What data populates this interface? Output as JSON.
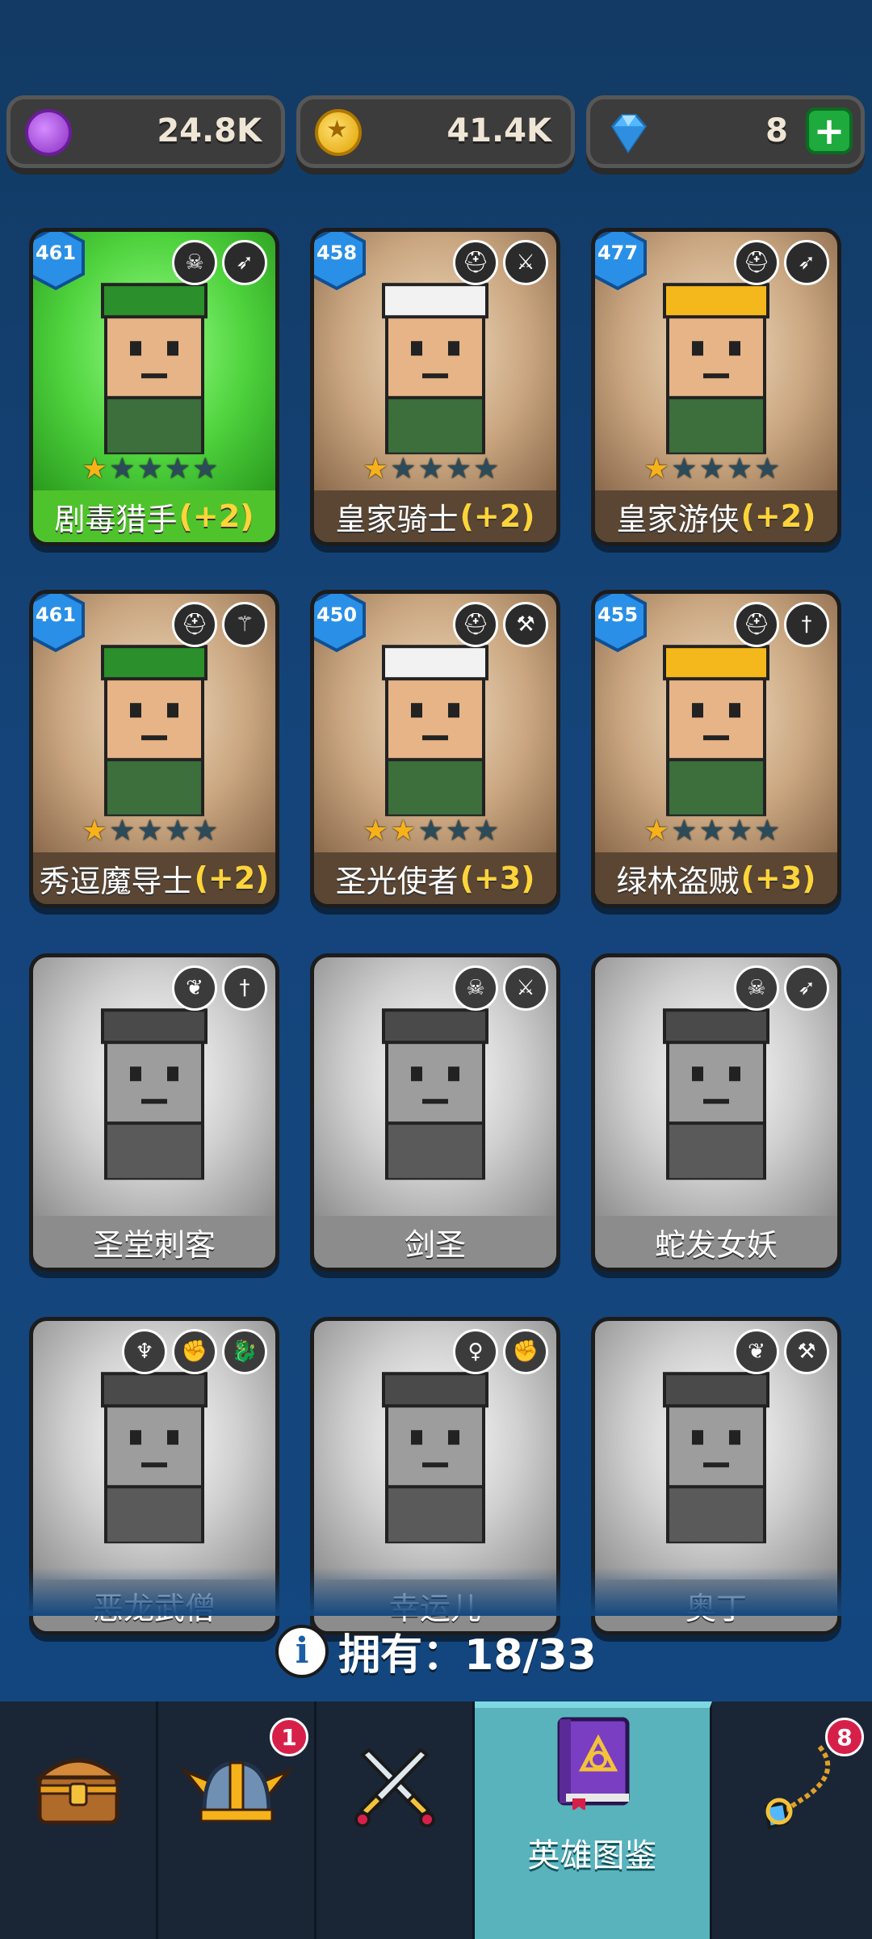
{
  "currencies": [
    {
      "name": "purple-coin",
      "value": "24.8K"
    },
    {
      "name": "gold-coin",
      "value": "41.4K"
    },
    {
      "name": "gem",
      "value": "8",
      "plus": "+"
    }
  ],
  "heroes": [
    {
      "name": "剧毒猎手",
      "bonus": "(+2)",
      "level": "461",
      "stars": 1,
      "owned": true,
      "theme": "green",
      "badges": [
        "orc-icon",
        "bow-icon"
      ]
    },
    {
      "name": "皇家骑士",
      "bonus": "(+2)",
      "level": "458",
      "stars": 1,
      "owned": true,
      "theme": "brown",
      "badges": [
        "helmet-icon",
        "sword-icon"
      ]
    },
    {
      "name": "皇家游侠",
      "bonus": "(+2)",
      "level": "477",
      "stars": 1,
      "owned": true,
      "theme": "brown",
      "badges": [
        "helmet-icon",
        "bow-icon"
      ]
    },
    {
      "name": "秀逗魔导士",
      "bonus": "(+2)",
      "level": "461",
      "stars": 1,
      "owned": true,
      "theme": "brown",
      "badges": [
        "helmet-icon",
        "staff-icon"
      ]
    },
    {
      "name": "圣光使者",
      "bonus": "(+3)",
      "level": "450",
      "stars": 2,
      "owned": true,
      "theme": "brown",
      "badges": [
        "helmet-icon",
        "hammer-icon"
      ]
    },
    {
      "name": "绿林盗贼",
      "bonus": "(+3)",
      "level": "455",
      "stars": 1,
      "owned": true,
      "theme": "brown",
      "badges": [
        "helmet-icon",
        "dagger-icon"
      ]
    },
    {
      "name": "圣堂刺客",
      "bonus": "",
      "level": "",
      "stars": 0,
      "owned": false,
      "badges": [
        "wings-icon",
        "dagger-icon"
      ]
    },
    {
      "name": "剑圣",
      "bonus": "",
      "level": "",
      "stars": 0,
      "owned": false,
      "badges": [
        "orc-icon",
        "sword-icon"
      ]
    },
    {
      "name": "蛇发女妖",
      "bonus": "",
      "level": "",
      "stars": 0,
      "owned": false,
      "badges": [
        "skull-icon",
        "bow-icon"
      ]
    },
    {
      "name": "恶龙武僧",
      "bonus": "",
      "level": "",
      "stars": 0,
      "owned": false,
      "badges": [
        "demon-icon",
        "fist-icon",
        "dragon-icon"
      ]
    },
    {
      "name": "幸运儿",
      "bonus": "",
      "level": "",
      "stars": 0,
      "owned": false,
      "badges": [
        "elf-icon",
        "fist-icon"
      ]
    },
    {
      "name": "奥丁",
      "bonus": "",
      "level": "",
      "stars": 0,
      "owned": false,
      "badges": [
        "wings-icon",
        "hammer-icon"
      ]
    }
  ],
  "collection": {
    "label": "拥有：",
    "count": "18/33"
  },
  "nav": {
    "tabs": [
      {
        "name": "chest-tab",
        "label": ""
      },
      {
        "name": "heroes-tab",
        "label": "",
        "badge": "1"
      },
      {
        "name": "battle-tab",
        "label": ""
      },
      {
        "name": "hero-codex-tab",
        "label": "英雄图鉴",
        "active": true
      },
      {
        "name": "amulet-tab",
        "label": "",
        "badge": "8"
      }
    ]
  },
  "colors": {
    "accent_tab": "#58b3bd",
    "bonus": "#ffd43a",
    "star_on": "#f7b21a",
    "level_badge": "#2a8fe6"
  }
}
